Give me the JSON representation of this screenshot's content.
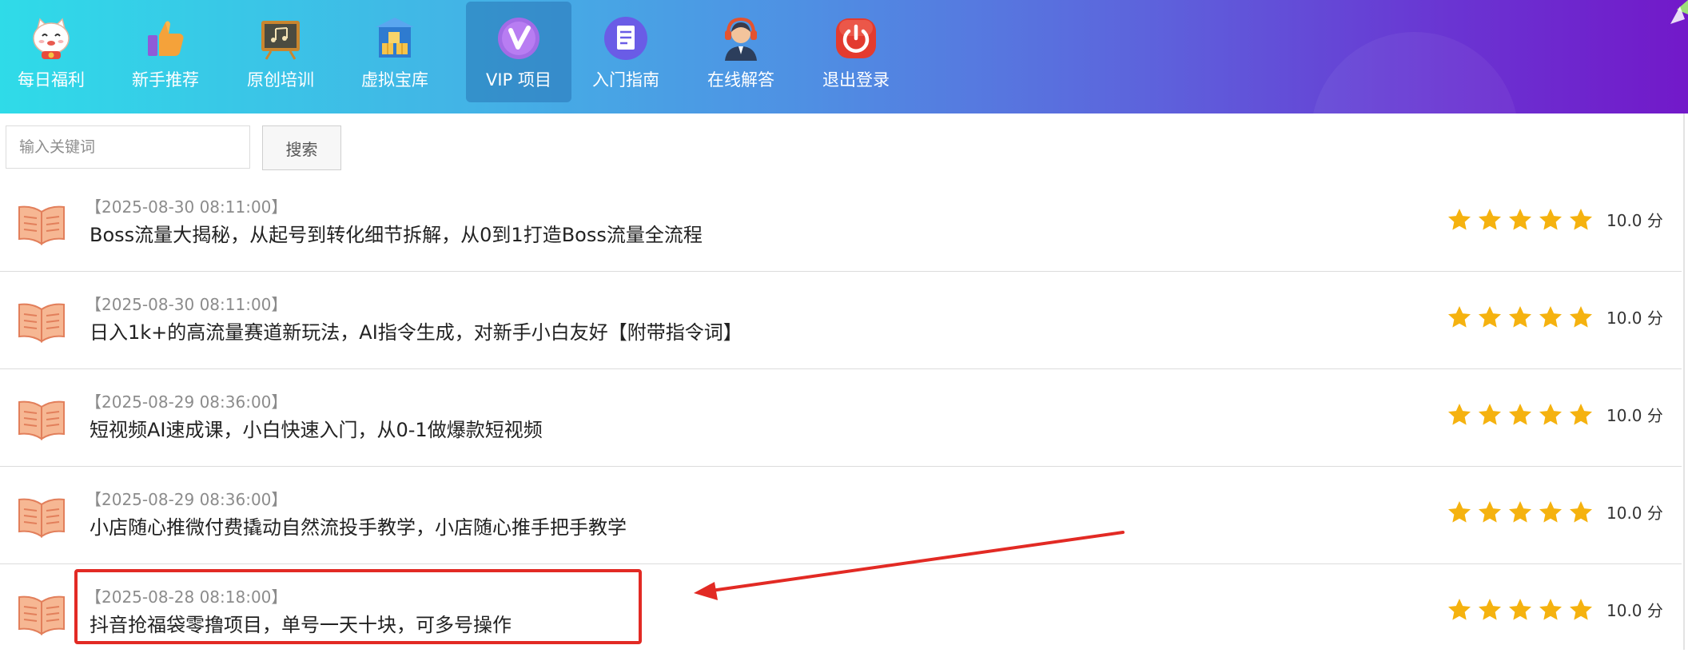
{
  "nav": {
    "items": [
      {
        "label": "每日福利",
        "icon": "lucky-cat-icon"
      },
      {
        "label": "新手推荐",
        "icon": "thumbs-up-icon"
      },
      {
        "label": "原创培训",
        "icon": "blackboard-icon"
      },
      {
        "label": "虚拟宝库",
        "icon": "treasure-boxes-icon"
      },
      {
        "label": "VIP 项目",
        "icon": "vip-badge-icon",
        "active": true
      },
      {
        "label": "入门指南",
        "icon": "guide-document-icon"
      },
      {
        "label": "在线解答",
        "icon": "support-agent-icon"
      },
      {
        "label": "退出登录",
        "icon": "power-off-icon"
      }
    ]
  },
  "search": {
    "placeholder": "输入关键词",
    "button_label": "搜索"
  },
  "articles": [
    {
      "date": "【2025-08-30 08:11:00】",
      "title": "Boss流量大揭秘，从起号到转化细节拆解，从0到1打造Boss流量全流程",
      "rating": 5,
      "score": "10.0 分"
    },
    {
      "date": "【2025-08-30 08:11:00】",
      "title": "日入1k+的高流量赛道新玩法，AI指令生成，对新手小白友好【附带指令词】",
      "rating": 5,
      "score": "10.0 分"
    },
    {
      "date": "【2025-08-29 08:36:00】",
      "title": "短视频AI速成课，小白快速入门，从0-1做爆款短视频",
      "rating": 5,
      "score": "10.0 分"
    },
    {
      "date": "【2025-08-29 08:36:00】",
      "title": "小店随心推微付费撬动自然流投手教学，小店随心推手把手教学",
      "rating": 5,
      "score": "10.0 分"
    },
    {
      "date": "【2025-08-28 08:18:00】",
      "title": "抖音抢福袋零撸项目，单号一天十块，可多号操作",
      "rating": 5,
      "score": "10.0 分",
      "highlighted": true
    }
  ],
  "colors": {
    "star": "#f5b20f",
    "annotation": "#e22a24",
    "book_icon": "#f2b08c"
  }
}
